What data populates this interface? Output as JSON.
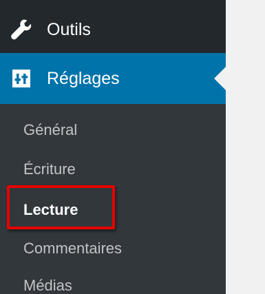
{
  "menu": {
    "outils": {
      "label": "Outils",
      "icon": "wrench-icon"
    },
    "reglages": {
      "label": "Réglages",
      "icon": "settings-sliders-icon",
      "active": true
    }
  },
  "submenu": {
    "items": [
      {
        "label": "Général"
      },
      {
        "label": "Écriture"
      },
      {
        "label": "Lecture",
        "current": true
      },
      {
        "label": "Commentaires"
      },
      {
        "label": "Médias"
      }
    ]
  },
  "colors": {
    "sidebar_background": "#23282d",
    "submenu_background": "#32373c",
    "active_menu_background": "#0073aa",
    "highlight_border": "#e60000",
    "content_background": "#f1f1f1"
  }
}
